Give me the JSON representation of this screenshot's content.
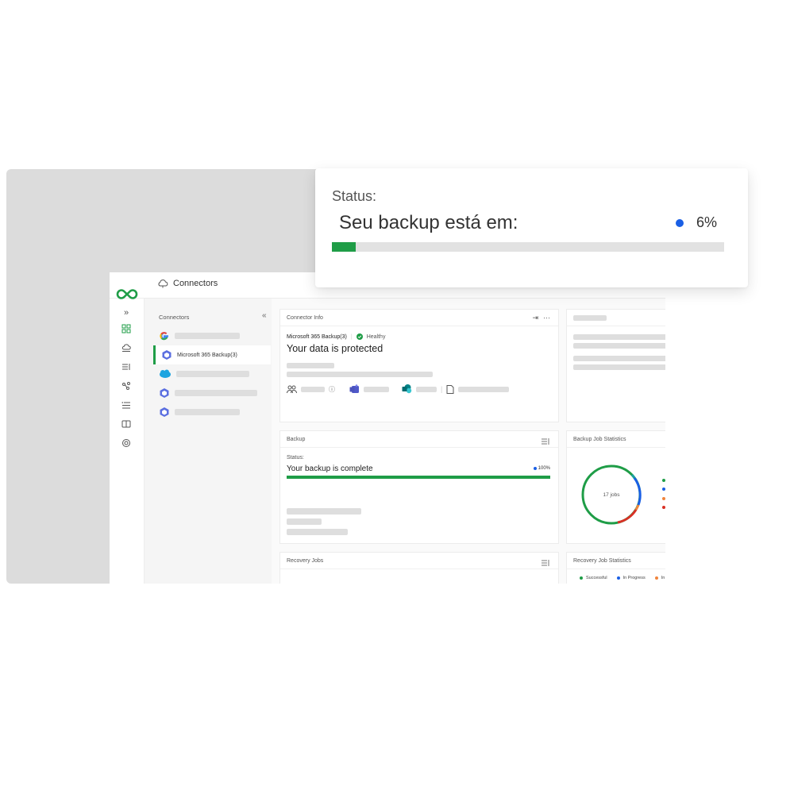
{
  "status_card": {
    "label": "Status:",
    "message": "Seu backup está em:",
    "percent_text": "6%",
    "progress": 0.06,
    "progress_color": "#1f9d47",
    "dot_color": "#1a5fe5"
  },
  "app": {
    "title": "Connectors",
    "panel": {
      "heading": "Connectors",
      "active_connector_label": "Microsoft 365 Backup(3)"
    },
    "connector_info": {
      "header": "Connector Info",
      "name": "Microsoft 365 Backup(3)",
      "health": "Healthy",
      "headline": "Your data is protected"
    },
    "backup": {
      "header": "Backup",
      "status_label": "Status:",
      "message": "Your backup is complete",
      "percent_text": "100%",
      "progress": 1.0
    },
    "backup_stats": {
      "header": "Backup Job Statistics",
      "center_label": "17 jobs"
    },
    "recovery_jobs": {
      "header": "Recovery Jobs"
    },
    "recovery_stats": {
      "header": "Recovery Job Statistics",
      "legend": [
        "Successful",
        "In Progress",
        "In"
      ]
    }
  },
  "colors": {
    "accent": "#1f9d47",
    "blue": "#1a5fe5",
    "orange": "#f0843c",
    "red": "#d93025",
    "teal": "#1aa0a0"
  }
}
